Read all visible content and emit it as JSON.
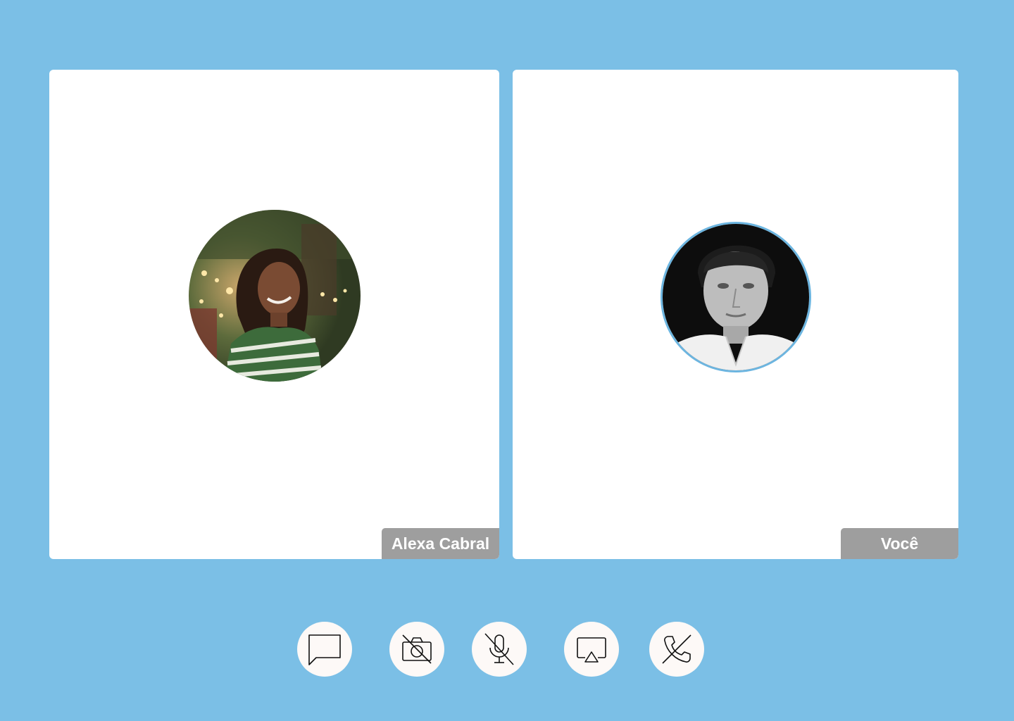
{
  "participants": [
    {
      "name": "Alexa Cabral",
      "avatar": "woman-smiling-photo"
    },
    {
      "name": "Você",
      "avatar": "man-portrait-bw-photo"
    }
  ],
  "controls": [
    {
      "icon": "chat-bubble-icon"
    },
    {
      "icon": "camera-off-icon"
    },
    {
      "icon": "mic-off-icon"
    },
    {
      "icon": "screen-share-icon"
    },
    {
      "icon": "end-call-icon"
    }
  ],
  "colors": {
    "background": "#7bbfe6",
    "tile": "#ffffff",
    "label_bg": "#9e9e9e",
    "avatar_ring": "#6cb5e0",
    "control_bg": "#fdf9f7"
  }
}
